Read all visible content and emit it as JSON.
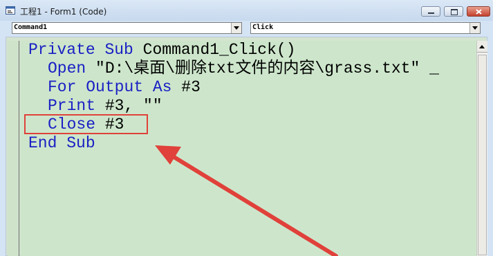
{
  "window": {
    "title": "工程1 - Form1 (Code)"
  },
  "object_combo": {
    "selected": "Command1"
  },
  "procedure_combo": {
    "selected": "Click"
  },
  "code": {
    "line1": {
      "kw1": "Private",
      "kw2": "Sub",
      "rest": "Command1_Click()"
    },
    "line2": {
      "kw": "Open",
      "rest": "\"D:\\桌面\\删除txt文件的内容\\grass.txt\" _"
    },
    "line3": {
      "kw1": "For",
      "kw2": "Output",
      "kw3": "As",
      "rest": "#3"
    },
    "line4": {
      "kw": "Print",
      "rest": "#3, \"\""
    },
    "line5": {
      "kw": "Close",
      "rest": "#3"
    },
    "line6": {
      "kw1": "End",
      "kw2": "Sub"
    }
  },
  "annotation": {
    "highlight_color": "#e0413a",
    "arrow_color": "#e0413a"
  },
  "colors": {
    "keyword": "#1b21c4",
    "code_background": "#cde6cb"
  },
  "icons": {
    "app": "vb-form-icon",
    "minimize": "minimize-icon",
    "maximize": "maximize-icon",
    "close": "close-icon"
  }
}
